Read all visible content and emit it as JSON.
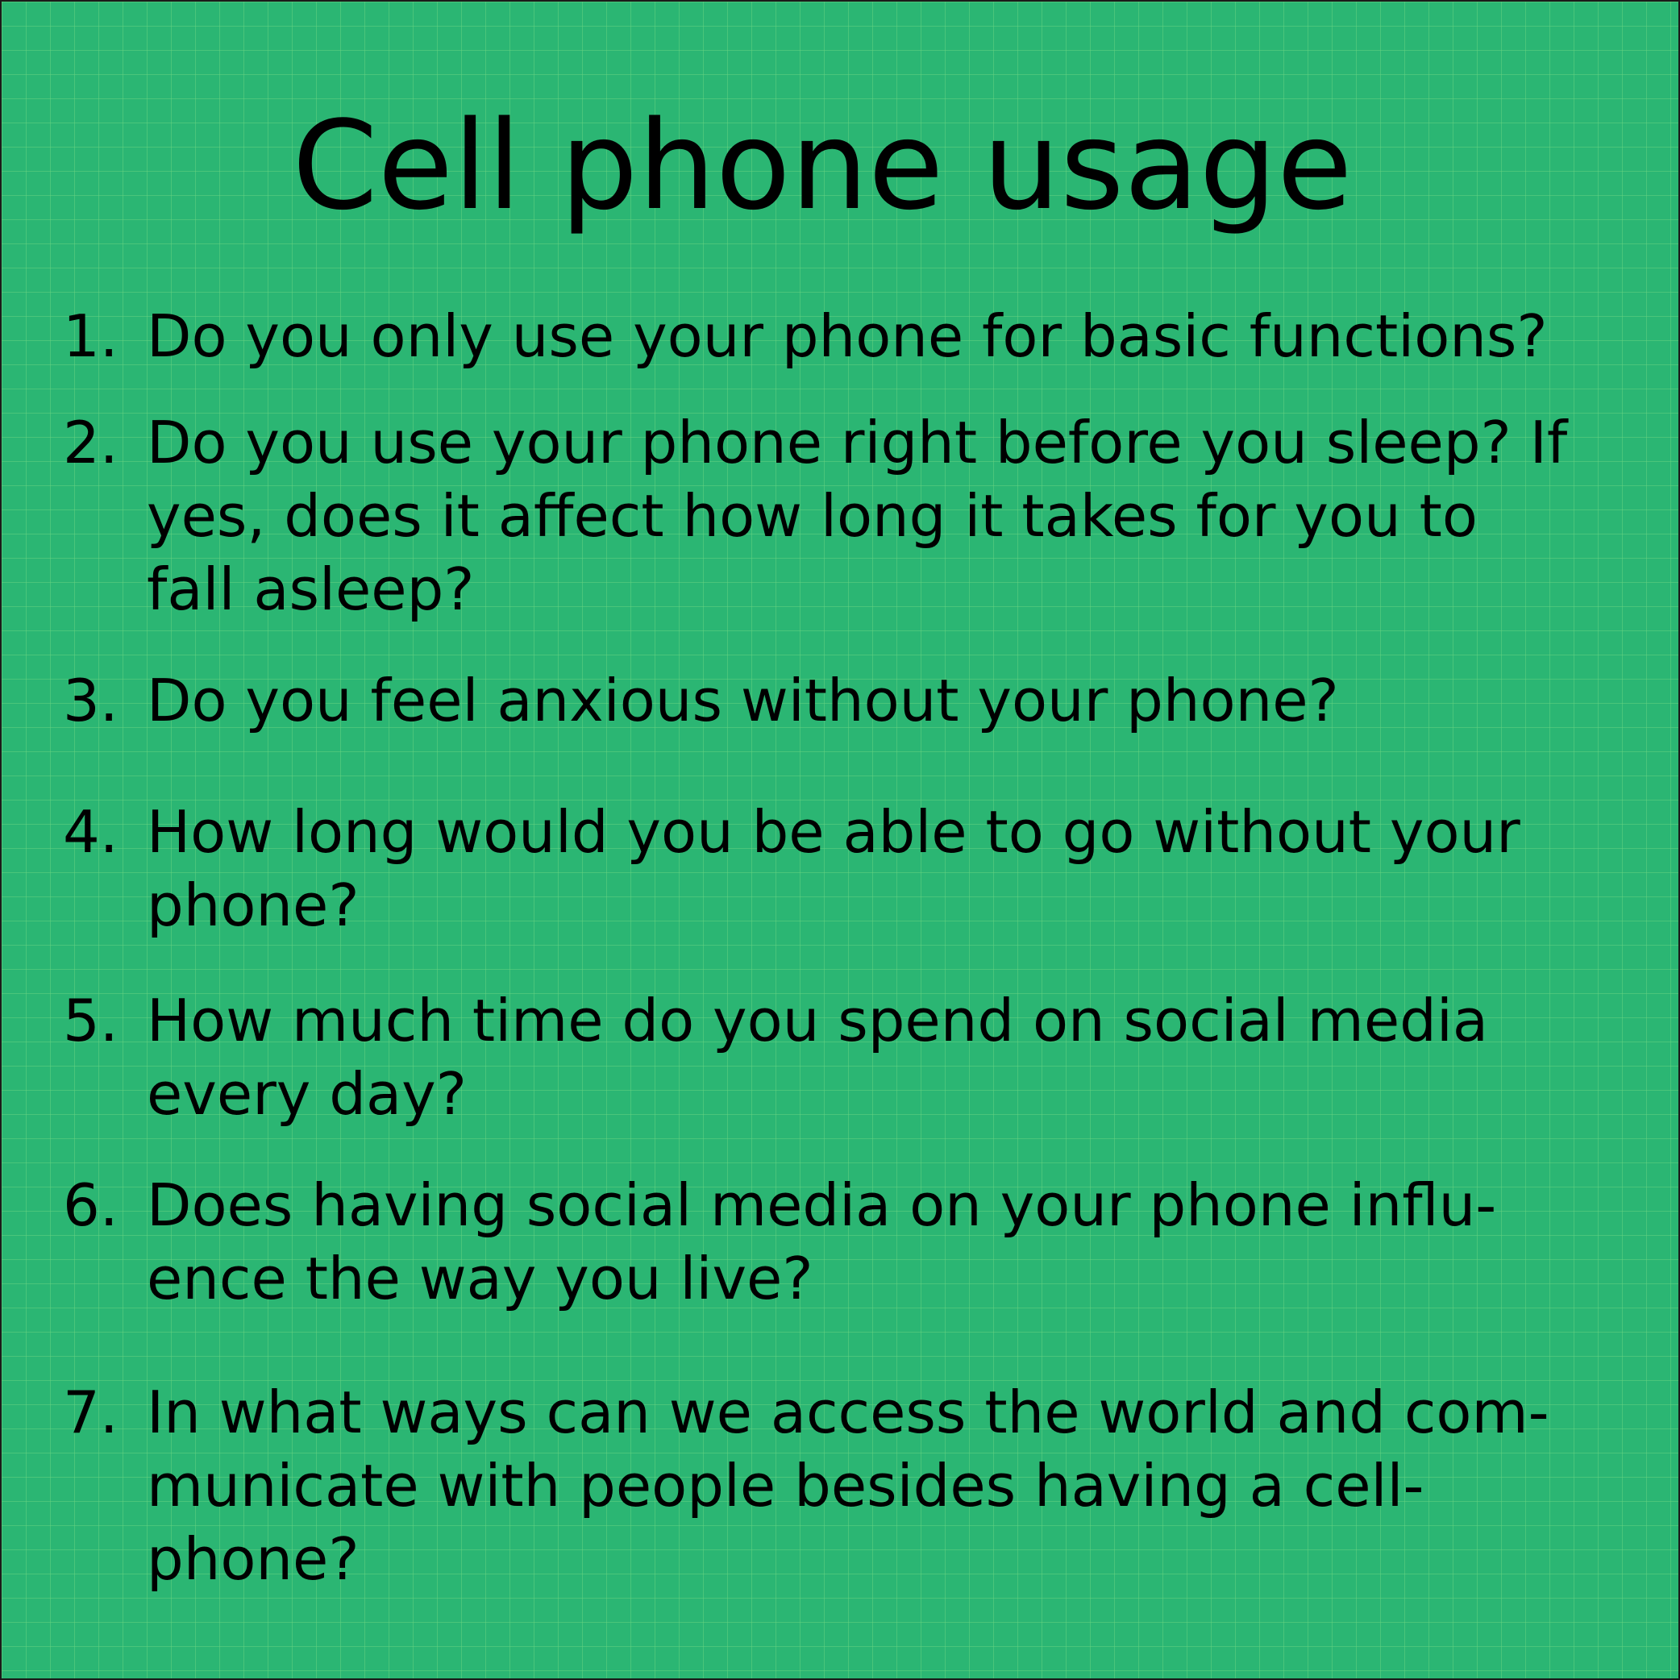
{
  "title": "Cell phone usage",
  "colors": {
    "background": "#2bb673",
    "grid": "#6ed782",
    "text": "#000000"
  },
  "questions": [
    {
      "number": "1.",
      "lines": [
        "Do you only use your phone for basic functions?"
      ]
    },
    {
      "number": "2.",
      "lines": [
        "Do you use your phone right before you sleep? If",
        "yes, does it affect how long it takes for you to",
        "fall asleep?"
      ]
    },
    {
      "number": "3.",
      "lines": [
        "Do you feel anxious without your phone?"
      ]
    },
    {
      "number": "4.",
      "lines": [
        "How long would you be able to go without your",
        "phone?"
      ]
    },
    {
      "number": "5.",
      "lines": [
        "How much time do you spend on social media",
        "every day?"
      ]
    },
    {
      "number": "6.",
      "lines": [
        "Does having social media on your phone influ-",
        "ence the way you live?"
      ]
    },
    {
      "number": "7.",
      "lines": [
        "In what ways can we access the world and com-",
        "municate with people besides having a cell-",
        "phone?"
      ]
    }
  ]
}
